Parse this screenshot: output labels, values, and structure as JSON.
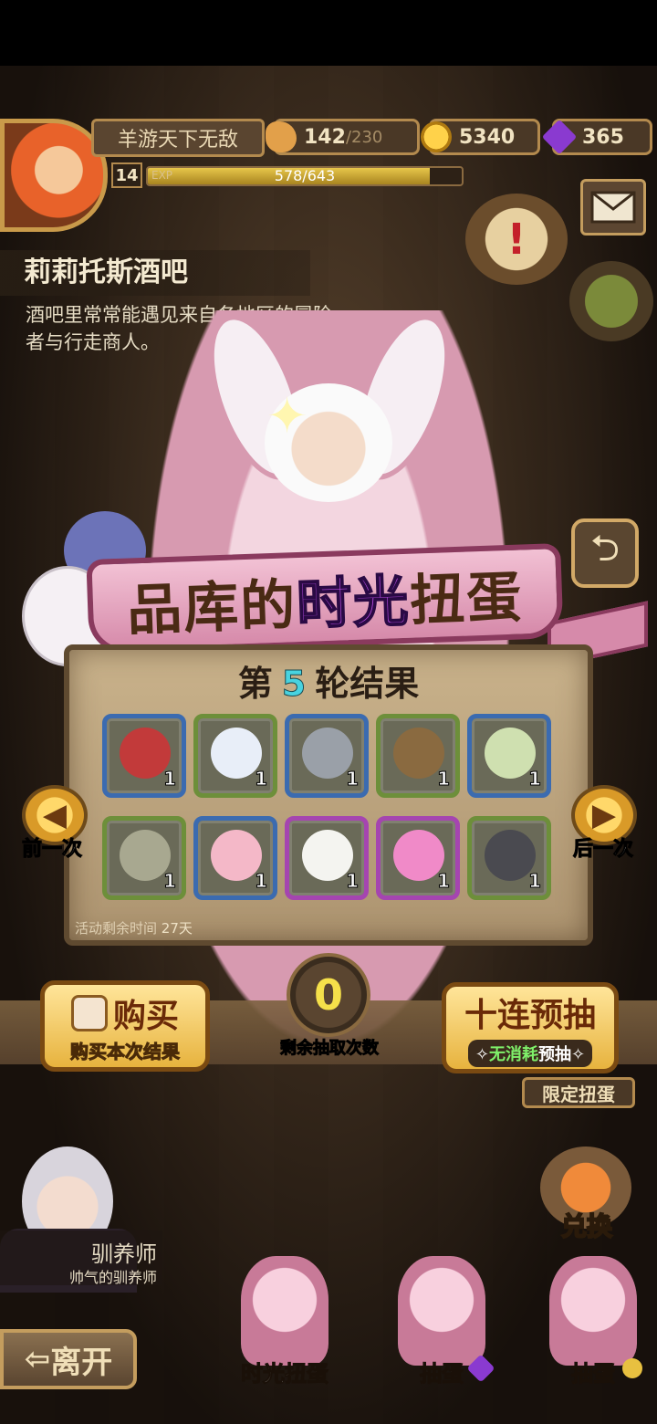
{
  "player": {
    "name": "羊游天下无敌",
    "level": "14",
    "exp_tag": "EXP",
    "exp_text": "578/643",
    "exp_fraction": 0.899
  },
  "resources": {
    "bread": {
      "value": "142",
      "max": "/230"
    },
    "gold": {
      "value": "5340"
    },
    "gems": {
      "value": "365"
    }
  },
  "location": {
    "title": "莉莉托斯酒吧",
    "description": "酒吧里常常能遇见来自各地区的冒险者与行走商人。"
  },
  "banner": {
    "title_prefix": "品库的",
    "title_highlight": "时光",
    "title_suffix": "扭蛋"
  },
  "results": {
    "round_prefix": "第",
    "round_number": "5",
    "round_suffix": "轮结果",
    "items": [
      {
        "count": "1",
        "rarity": "blue",
        "icon": "helmet-icon",
        "color": "#c23a3a"
      },
      {
        "count": "1",
        "rarity": "green",
        "icon": "cotton-planet-icon",
        "color": "#e8eef8"
      },
      {
        "count": "1",
        "rarity": "blue",
        "icon": "cleaver-icon",
        "color": "#9aa0a8"
      },
      {
        "count": "1",
        "rarity": "green",
        "icon": "barrel-icon",
        "color": "#8a6a40"
      },
      {
        "count": "1",
        "rarity": "blue",
        "icon": "leaf-pouch-icon",
        "color": "#cfe0b0"
      },
      {
        "count": "1",
        "rarity": "green",
        "icon": "leaf-bundle-icon",
        "color": "#a8a890"
      },
      {
        "count": "1",
        "rarity": "blue",
        "icon": "lotus-bun-icon",
        "color": "#f4b8c8"
      },
      {
        "count": "1",
        "rarity": "purple",
        "icon": "flower-blossom-icon",
        "color": "#f4f4f0"
      },
      {
        "count": "1",
        "rarity": "purple",
        "icon": "pink-spirit-icon",
        "color": "#f08ac8"
      },
      {
        "count": "1",
        "rarity": "green",
        "icon": "egg-nest-icon",
        "color": "#4a4a50"
      }
    ],
    "timer_label": "活动剩余时间",
    "timer_value": "27天"
  },
  "nav": {
    "prev_label": "前一次",
    "next_label": "后一次"
  },
  "actions": {
    "buy_main": "购买",
    "buy_sub": "购买本次结果",
    "counter_value": "0",
    "counter_label": "剩余抽取次数",
    "ten_main": "十连预抽",
    "ten_sub_green": "无消耗",
    "ten_sub_rest": "预抽",
    "limited_label": "限定扭蛋"
  },
  "side": {
    "exchange_label": "兑换",
    "npc_title": "驯养师",
    "npc_subtitle": "帅气的驯养师",
    "leave_label": "离开"
  },
  "tabs": [
    {
      "label": "时光扭蛋"
    },
    {
      "label": "抽蛋"
    },
    {
      "label": "抽蛋"
    }
  ],
  "colors": {
    "blue_rarity": "#3b6bb0",
    "green_rarity": "#6d8f3a",
    "purple_rarity": "#a545b0",
    "round_number": "#48d3e0",
    "counter": "#f5e04a"
  }
}
